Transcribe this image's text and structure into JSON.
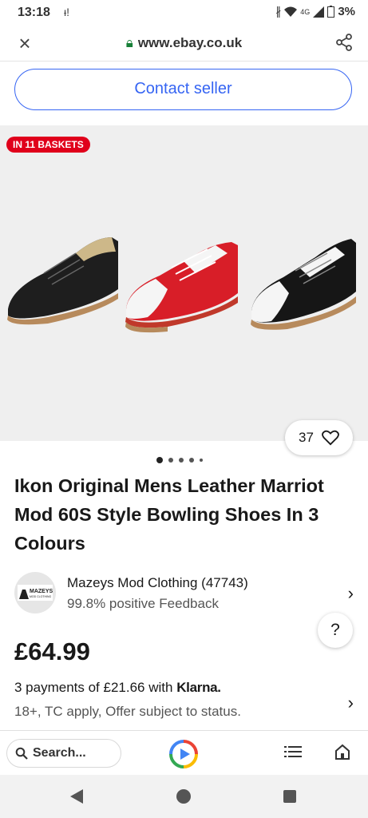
{
  "status": {
    "time": "13:18",
    "network": "4G",
    "battery": "3%"
  },
  "browser": {
    "url": "www.ebay.co.uk"
  },
  "contact_seller": "Contact seller",
  "gallery": {
    "badge": "IN 11 BASKETS",
    "watch_count": "37",
    "image_count": 5,
    "active_index": 0
  },
  "product": {
    "title": "Ikon Original Mens Leather Marriot Mod 60S Style Bowling Shoes In 3 Colours"
  },
  "seller": {
    "name": "Mazeys Mod Clothing (47743)",
    "feedback": "99.8% positive Feedback",
    "logo_text": "MAZEYS",
    "logo_subtext": "MOD CLOTHING"
  },
  "help_label": "?",
  "price": "£64.99",
  "klarna": {
    "payments": "3 payments of £21.66 with",
    "brand": "Klarna.",
    "terms": "18+, TC apply, Offer subject to status."
  },
  "bottom_nav": {
    "search_placeholder": "Search..."
  },
  "colors": {
    "accent": "#3665f3",
    "badge": "#e0001b",
    "lock": "#188038"
  }
}
